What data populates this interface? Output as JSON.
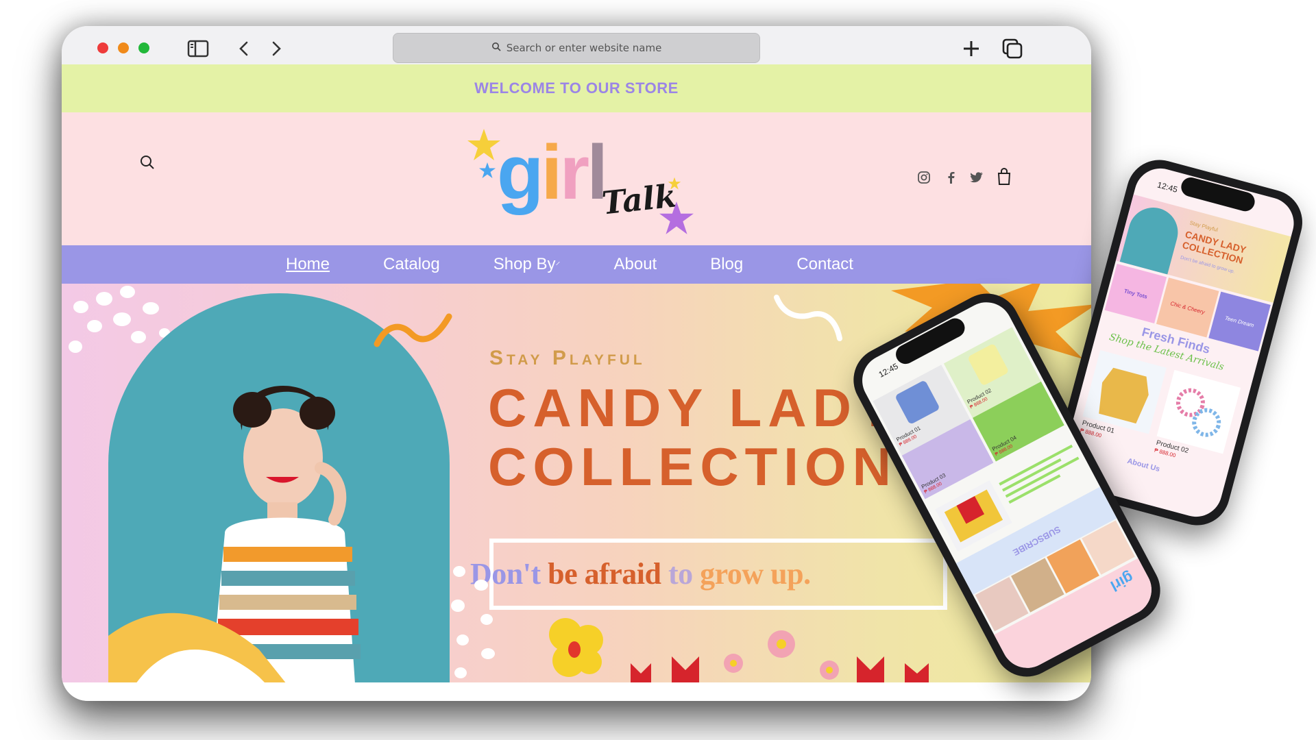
{
  "browser": {
    "address_placeholder": "Search or enter website name"
  },
  "store": {
    "announcement": "WELCOME TO OUR STORE",
    "logo": {
      "word": [
        "g",
        "i",
        "r",
        "l"
      ],
      "word_colors": [
        "#4aa6f0",
        "#f6a94a",
        "#f0a0c0",
        "#a08a9a"
      ],
      "script": "Talk"
    },
    "nav": [
      "Home",
      "Catalog",
      "Shop By",
      "About",
      "Blog",
      "Contact"
    ],
    "active_nav": "Home",
    "social_icons": [
      "instagram-icon",
      "facebook-icon",
      "twitter-icon",
      "bag-icon"
    ]
  },
  "hero": {
    "eyebrow": "Stay Playful",
    "title_line1": "CANDY LADY",
    "title_line2": "COLLECTION",
    "tagline": {
      "dont": "Don't",
      "be_afraid": "be afraid",
      "to": "to",
      "grow_up": "grow up."
    },
    "colors": {
      "title": "#d6602c",
      "eyebrow": "#d19b4a",
      "dont": "#9a96e6",
      "be_afraid": "#d6602c",
      "to": "#b9a6d8",
      "grow_up": "#f4a25a"
    }
  },
  "phone_front": {
    "time": "12:45",
    "products": [
      {
        "name": "Product 01",
        "price": "₱ 888.00"
      },
      {
        "name": "Product 02",
        "price": "₱ 888.00"
      },
      {
        "name": "Product 03",
        "price": "₱ 888.00"
      },
      {
        "name": "Product 04",
        "price": "₱ 888.00"
      }
    ],
    "subscribe": "SUBSCRIBE",
    "logo": "girl"
  },
  "phone_back": {
    "time": "12:45",
    "hero_eyebrow": "Stay Playful",
    "hero_title": "CANDY LADY COLLECTION",
    "hero_tagline": "Don't be afraid to grow up.",
    "tiles": [
      "Tiny Tots",
      "Chic & Cheery",
      "Teen Dream"
    ],
    "section_title": "Fresh Finds",
    "section_script": "Shop the Latest Arrivals",
    "products": [
      {
        "name": "Product 01",
        "price": "₱ 888.00"
      },
      {
        "name": "Product 02",
        "price": "₱ 888.00"
      }
    ],
    "about": "About Us"
  }
}
